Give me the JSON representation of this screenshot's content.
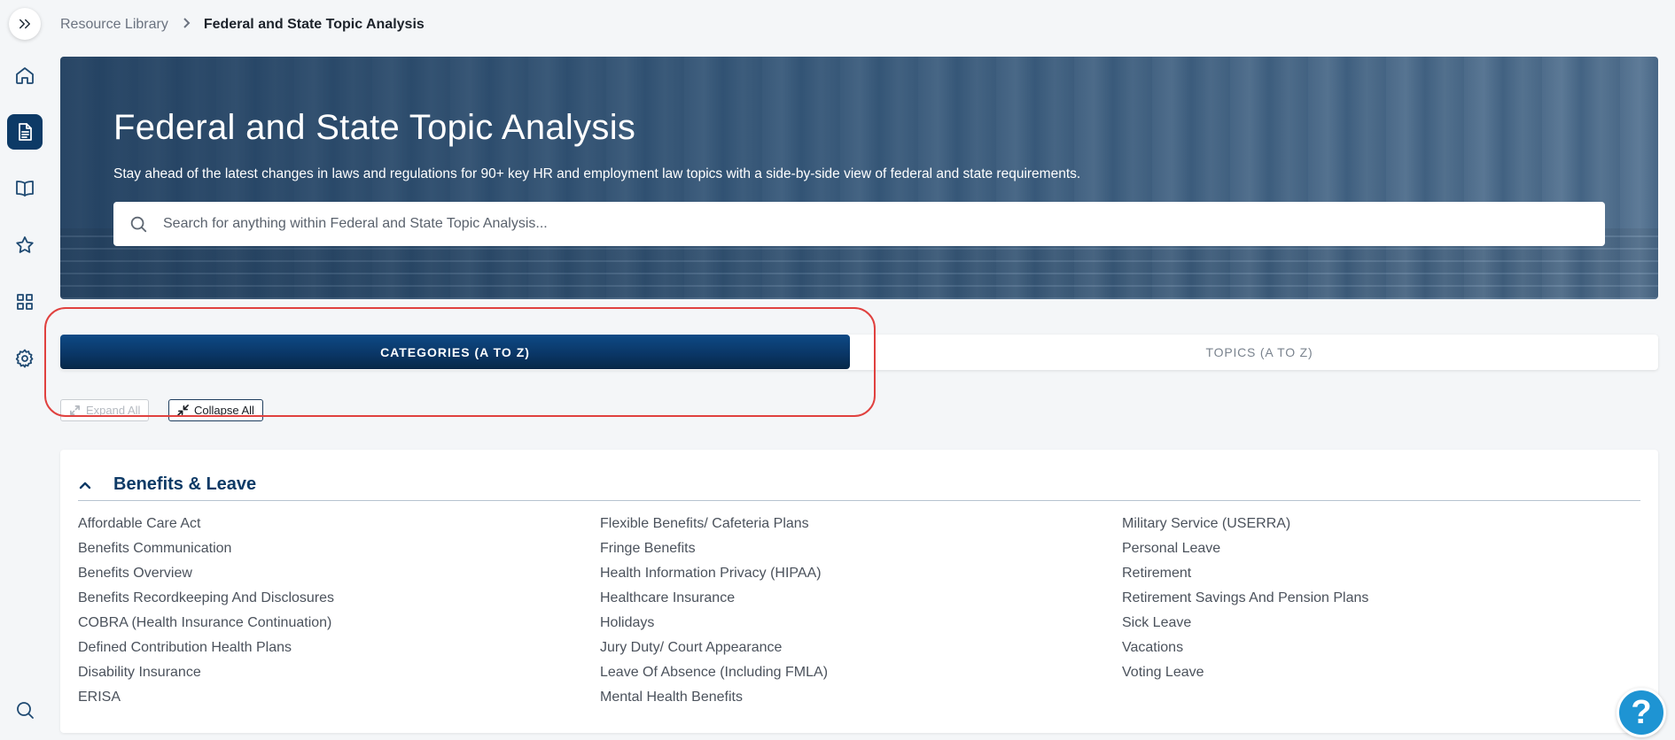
{
  "breadcrumb": {
    "parent": "Resource Library",
    "current": "Federal and State Topic Analysis"
  },
  "sidebar": {
    "items": [
      {
        "icon": "expand-icon"
      },
      {
        "icon": "home-icon"
      },
      {
        "icon": "document-icon",
        "active": true
      },
      {
        "icon": "book-icon"
      },
      {
        "icon": "star-icon"
      },
      {
        "icon": "grid-icon"
      },
      {
        "icon": "gear-icon"
      },
      {
        "icon": "search-icon"
      }
    ]
  },
  "hero": {
    "title": "Federal and State Topic Analysis",
    "subtitle": "Stay ahead of the latest changes in laws and regulations for 90+ key HR and employment law topics with a side-by-side view of federal and state requirements.",
    "search_placeholder": "Search for anything within Federal and State Topic Analysis..."
  },
  "tabs": {
    "categories": "CATEGORIES (A TO Z)",
    "topics": "TOPICS (A TO Z)",
    "active": "categories"
  },
  "controls": {
    "expand_all": "Expand All",
    "collapse_all": "Collapse All"
  },
  "category": {
    "title": "Benefits & Leave",
    "columns": [
      [
        "Affordable Care Act",
        "Benefits Communication",
        "Benefits Overview",
        "Benefits Recordkeeping And Disclosures",
        "COBRA (Health Insurance Continuation)",
        "Defined Contribution Health Plans",
        "Disability Insurance",
        "ERISA"
      ],
      [
        "Flexible Benefits/ Cafeteria Plans",
        "Fringe Benefits",
        "Health Information Privacy (HIPAA)",
        "Healthcare Insurance",
        "Holidays",
        "Jury Duty/ Court Appearance",
        "Leave Of Absence (Including FMLA)",
        "Mental Health Benefits"
      ],
      [
        "Military Service (USERRA)",
        "Personal Leave",
        "Retirement",
        "Retirement Savings And Pension Plans",
        "Sick Leave",
        "Vacations",
        "Voting Leave"
      ]
    ]
  },
  "help": {
    "label": "?"
  },
  "colors": {
    "primary": "#0d3a66",
    "highlight": "#e0413f",
    "help": "#1e94d3"
  }
}
